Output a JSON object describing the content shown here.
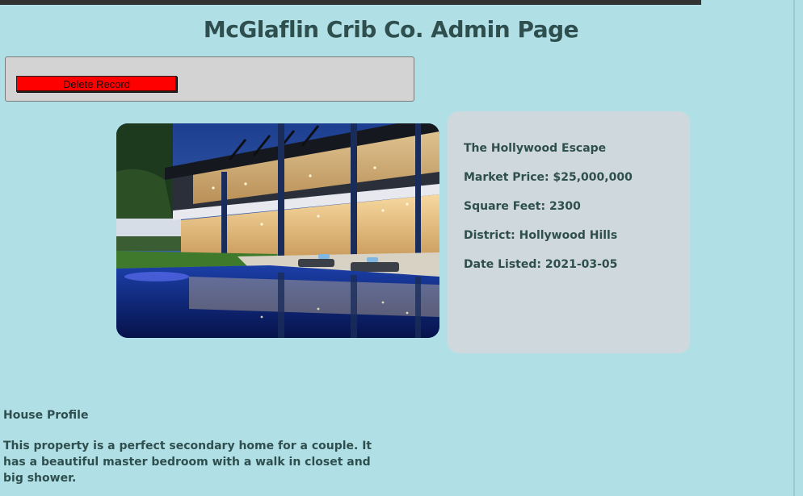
{
  "header": {
    "title": "McGlaflin Crib Co. Admin Page"
  },
  "admin": {
    "delete_label": "Delete Record"
  },
  "property": {
    "image_alt": "House photo",
    "name": "The Hollywood Escape",
    "market_price": "Market Price: $25,000,000",
    "square_feet": "Square Feet: 2300",
    "district": "District: Hollywood Hills",
    "date_listed": "Date Listed: 2021-03-05"
  },
  "profile": {
    "heading": "House Profile",
    "description": "This property is a perfect secondary home for a couple. It has a beautiful master bedroom with a walk in closet and big shower."
  },
  "colors": {
    "background": "#b0dfe5",
    "title_text": "#2f4f4f",
    "delete_button": "#ff0000",
    "panel": "#d3d3d3",
    "info_card": "#cfd8dc"
  }
}
